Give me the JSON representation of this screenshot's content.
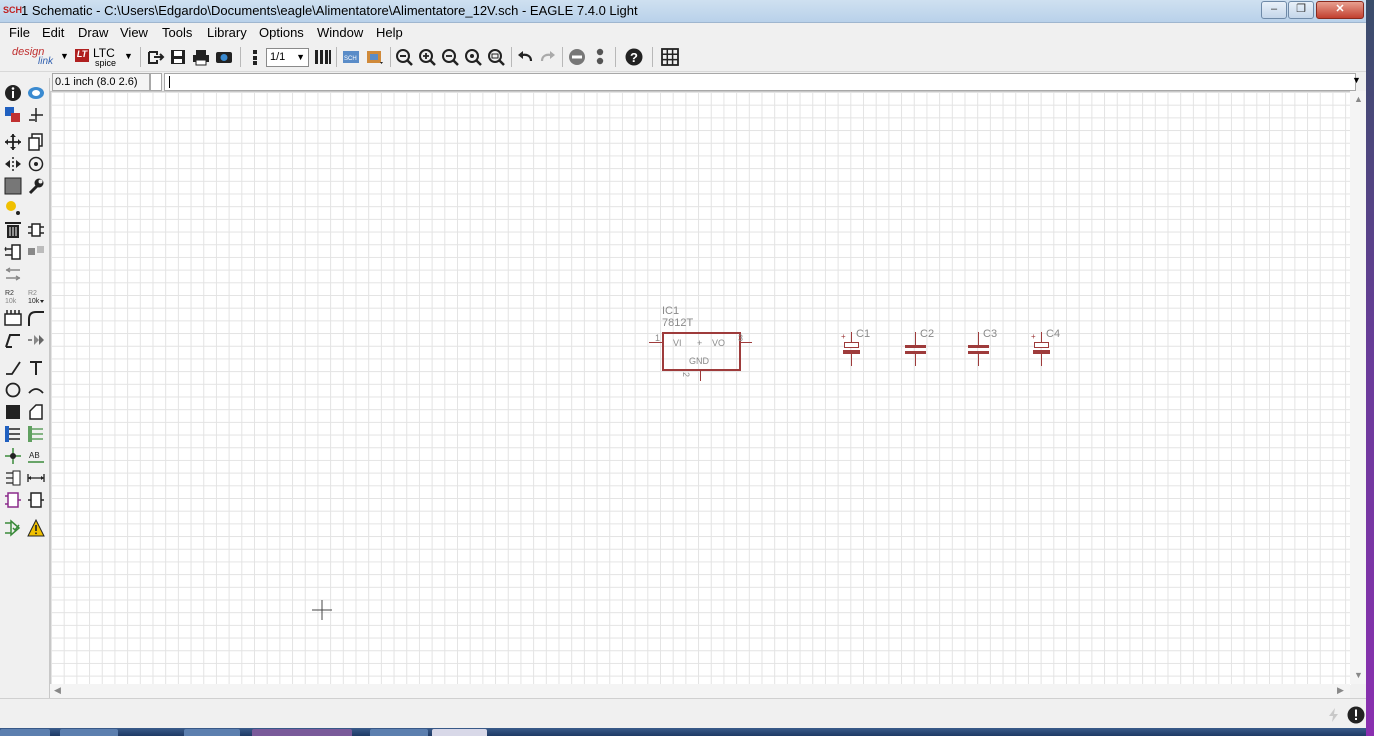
{
  "window": {
    "title": "1 Schematic - C:\\Users\\Edgardo\\Documents\\eagle\\Alimentatore\\Alimentatore_12V.sch - EAGLE 7.4.0 Light",
    "icon_label": "SCH",
    "minimize_label": "–",
    "maximize_label": "❐",
    "close_label": "✕"
  },
  "menu": [
    "File",
    "Edit",
    "Draw",
    "View",
    "Tools",
    "Library",
    "Options",
    "Window",
    "Help"
  ],
  "toolbar": {
    "designlink_top": "design",
    "designlink_bottom": "link",
    "ltc_top": "LTC",
    "ltc_bottom": "spice",
    "sheet_select": "1/1"
  },
  "command_line": {
    "coordinates": "0.1 inch (8.0 2.6)",
    "input_value": ""
  },
  "schematic": {
    "ic": {
      "name": "IC1",
      "value": "7812T",
      "pin_vi": "VI",
      "pin_vo": "VO",
      "pin_gnd": "GND",
      "pin1": "1",
      "pin2": "2",
      "pin3": "3",
      "center_mark": "+"
    },
    "capacitors": [
      {
        "name": "C1",
        "polarized": true,
        "plus": "+"
      },
      {
        "name": "C2",
        "polarized": false,
        "plus": ""
      },
      {
        "name": "C3",
        "polarized": false,
        "plus": ""
      },
      {
        "name": "C4",
        "polarized": true,
        "plus": "+"
      }
    ],
    "colors": {
      "symbol": "#9e3b3b",
      "text": "#8a8a8a",
      "grid": "#e3e3e3"
    }
  }
}
